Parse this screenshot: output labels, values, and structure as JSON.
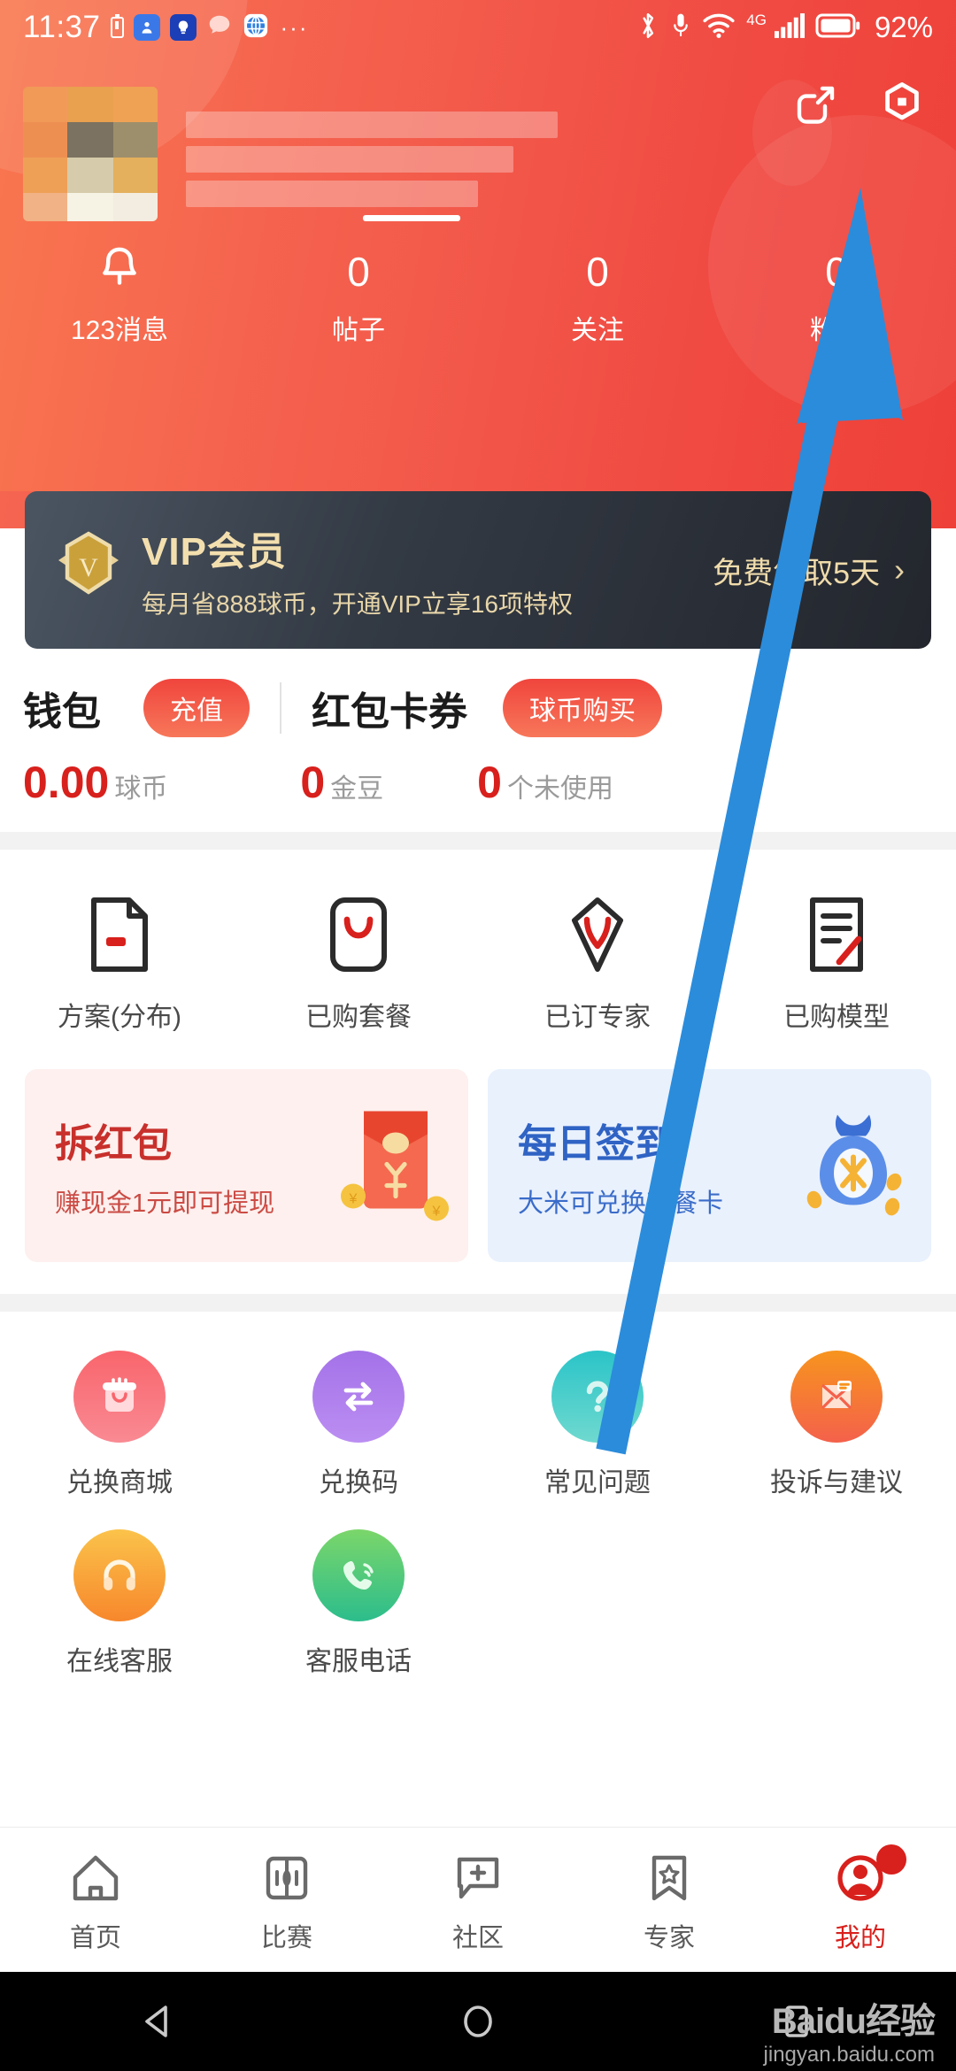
{
  "status_bar": {
    "time": "11:37",
    "icons": [
      "battery-alert-icon",
      "location-icon",
      "bulb-icon",
      "message-icon",
      "browser-icon",
      "more-dots-icon"
    ],
    "dots": "···",
    "network_label": "4G",
    "battery_percent": "92%"
  },
  "header": {
    "share_icon": "share-icon",
    "settings_icon": "hexagon-settings-icon",
    "profile_name_hidden": true,
    "stats": [
      {
        "value": "",
        "label": "123消息",
        "icon": "bell-icon"
      },
      {
        "value": "0",
        "label": "帖子",
        "icon": ""
      },
      {
        "value": "0",
        "label": "关注",
        "icon": ""
      },
      {
        "value": "0",
        "label": "粉丝",
        "icon": ""
      }
    ]
  },
  "vip_banner": {
    "badge_letter": "V",
    "title": "VIP会员",
    "subtitle": "每月省888球币，开通VIP立享16项特权",
    "cta": "免费领取5天",
    "chevron": "›"
  },
  "wallet": {
    "title": "钱包",
    "recharge_label": "充值",
    "coupon_title": "红包卡券",
    "buy_label": "球币购买",
    "balance_value": "0.00",
    "balance_unit": "球币",
    "bean_value": "0",
    "bean_unit": "金豆",
    "coupon_value": "0",
    "coupon_unit": "个未使用"
  },
  "quick_items": [
    {
      "label": "方案(分布)",
      "icon": "document-minus-icon"
    },
    {
      "label": "已购套餐",
      "icon": "package-v-icon"
    },
    {
      "label": "已订专家",
      "icon": "diamond-v-icon"
    },
    {
      "label": "已购模型",
      "icon": "document-edit-icon"
    }
  ],
  "promos": [
    {
      "title": "拆红包",
      "subtitle": "赚现金1元即可提现",
      "icon": "red-envelope-icon",
      "theme": "red"
    },
    {
      "title": "每日签到",
      "subtitle": "大米可兑换套餐卡",
      "icon": "money-bag-icon",
      "theme": "blue"
    }
  ],
  "services": [
    {
      "label": "兑换商城",
      "icon": "gift-shop-icon",
      "color": "#f9656c"
    },
    {
      "label": "兑换码",
      "icon": "exchange-arrows-icon",
      "color": "#a472e8"
    },
    {
      "label": "常见问题",
      "icon": "question-mark-icon",
      "color": "#2bc4c8"
    },
    {
      "label": "投诉与建议",
      "icon": "envelope-icon",
      "color": "#f7941e"
    },
    {
      "label": "在线客服",
      "icon": "headphones-icon",
      "color": "#fbc34a"
    },
    {
      "label": "客服电话",
      "icon": "phone-call-icon",
      "color": "#2cbd8c"
    }
  ],
  "bottom_nav": {
    "items": [
      {
        "label": "首页",
        "icon": "home-icon",
        "active": false
      },
      {
        "label": "比赛",
        "icon": "match-icon",
        "active": false
      },
      {
        "label": "社区",
        "icon": "community-plus-icon",
        "active": false
      },
      {
        "label": "专家",
        "icon": "bookmark-star-icon",
        "active": false
      },
      {
        "label": "我的",
        "icon": "profile-icon",
        "active": true
      }
    ]
  },
  "android_nav": {
    "back_icon": "back-triangle-icon",
    "home_icon": "home-circle-icon",
    "recent_icon": "recents-square-icon"
  },
  "watermark": {
    "main": "Baidu经验",
    "sub": "jingyan.baidu.com"
  },
  "annotation": {
    "arrow_color": "#2b8cdb",
    "points_from": "常见问题",
    "points_to": "hexagon-settings-icon"
  },
  "colors": {
    "header_start": "#f9774f",
    "header_end": "#ee4038",
    "accent_red": "#d8201c",
    "vip_gold": "#f3dfae",
    "vip_bg": "#23262d"
  }
}
